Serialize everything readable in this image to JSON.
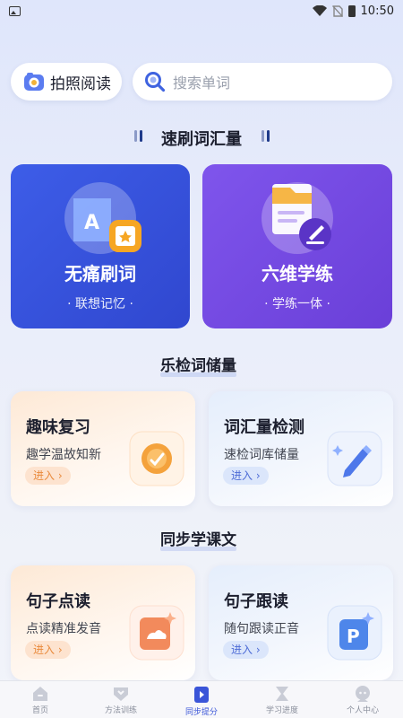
{
  "status_bar": {
    "time": "10:50"
  },
  "top": {
    "photo_read_label": "拍照阅读",
    "search_placeholder": "搜索单词"
  },
  "sections": {
    "vocab_title": "速刷词汇量",
    "check_title": "乐检词储量",
    "sync_title": "同步学课文"
  },
  "big_cards": [
    {
      "title": "无痛刷词",
      "subtitle": "· 联想记忆 ·",
      "icon": "word-book-icon"
    },
    {
      "title": "六维学练",
      "subtitle": "· 学练一体 ·",
      "icon": "practice-doc-icon"
    }
  ],
  "feature_cards": [
    {
      "title": "趣味复习",
      "desc": "趣学温故知新",
      "enter": "进入",
      "icon": "review-badge-icon"
    },
    {
      "title": "词汇量检测",
      "desc": "速检词库储量",
      "enter": "进入",
      "icon": "pen-check-icon"
    },
    {
      "title": "句子点读",
      "desc": "点读精准发音",
      "enter": "进入",
      "icon": "sentence-read-icon"
    },
    {
      "title": "句子跟读",
      "desc": "随句跟读正音",
      "enter": "进入",
      "icon": "follow-read-icon"
    }
  ],
  "nav": [
    {
      "label": "首页",
      "icon": "home-icon"
    },
    {
      "label": "方法训练",
      "icon": "shield-icon"
    },
    {
      "label": "同步提分",
      "icon": "book-icon",
      "active": true
    },
    {
      "label": "学习进度",
      "icon": "hourglass-icon"
    },
    {
      "label": "个人中心",
      "icon": "user-icon"
    }
  ],
  "colors": {
    "accent_blue": "#3a55d8",
    "card_blue": "#3d5de8",
    "card_purple": "#7f55ec",
    "enter_orange": "#e98a3c"
  }
}
